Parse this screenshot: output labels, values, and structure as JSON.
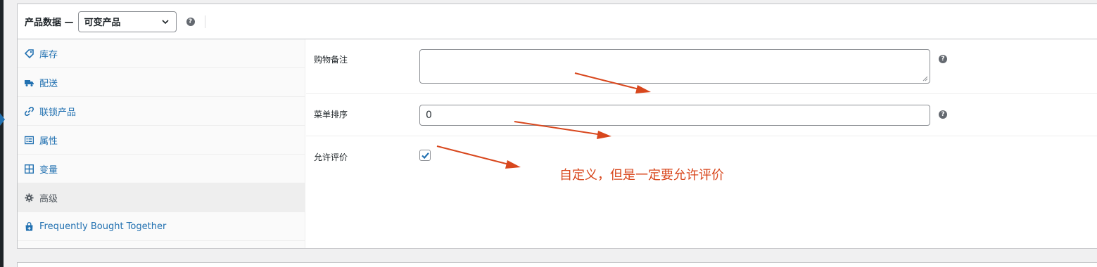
{
  "header": {
    "title": "产品数据 —",
    "product_type": "可变产品"
  },
  "tabs": [
    {
      "label": "库存",
      "icon": "tag-icon"
    },
    {
      "label": "配送",
      "icon": "truck-icon"
    },
    {
      "label": "联锁产品",
      "icon": "link-icon"
    },
    {
      "label": "属性",
      "icon": "list-icon"
    },
    {
      "label": "变量",
      "icon": "grid-icon"
    },
    {
      "label": "高级",
      "icon": "gear-icon"
    },
    {
      "label": "Frequently Bought Together",
      "icon": "bag-icon"
    }
  ],
  "fields": {
    "purchase_note_label": "购物备注",
    "purchase_note_value": "",
    "menu_order_label": "菜单排序",
    "menu_order_value": "0",
    "enable_reviews_label": "允许评价",
    "enable_reviews_checked": true
  },
  "annotation": "自定义，但是一定要允许评价",
  "colors": {
    "link": "#2271b1",
    "annotation": "#d8471d"
  }
}
